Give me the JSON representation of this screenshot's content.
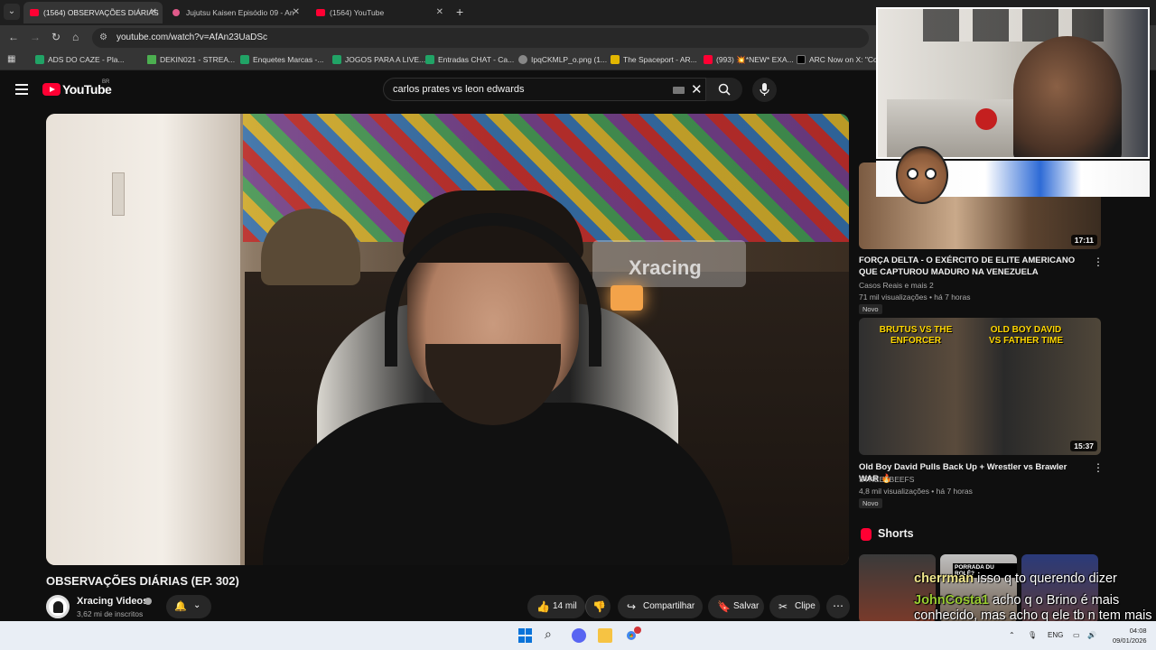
{
  "browser": {
    "tabs": [
      {
        "label": "(1564) OBSERVAÇÕES DIÁRIAS",
        "active": true
      },
      {
        "label": "Jujutsu Kaisen Episódio 09 - An",
        "active": false
      },
      {
        "label": "(1564) YouTube",
        "active": false
      }
    ],
    "url": "youtube.com/watch?v=AfAn23UaDSc",
    "bookmarks": [
      {
        "label": "ADS DO CAZE - Pla...",
        "icon": "sheets-icon"
      },
      {
        "label": "DEKIN021 - STREA...",
        "icon": "drive-icon"
      },
      {
        "label": "Enquetes Marcas -...",
        "icon": "sheets-icon"
      },
      {
        "label": "JOGOS PARA A LIVE...",
        "icon": "sheets-icon"
      },
      {
        "label": "Entradas CHAT - Ca...",
        "icon": "sheets-icon"
      },
      {
        "label": "IpqCKMLP_o.png (1...",
        "icon": "globe-icon"
      },
      {
        "label": "The Spaceport - AR...",
        "icon": "spaceport-icon"
      },
      {
        "label": "(993) 💥*NEW* EXA...",
        "icon": "youtube-icon"
      },
      {
        "label": "ARC Now on X: \"Co...",
        "icon": "x-icon"
      }
    ]
  },
  "youtube": {
    "logo_text": "YouTube",
    "country_code": "BR",
    "search_query": "carlos prates vs leon edwards",
    "player": {
      "brand_text": "Xracing"
    },
    "video": {
      "title": "OBSERVAÇÕES DIÁRIAS (EP. 302)",
      "channel": "Xracing Videos",
      "subscribers": "3,62 mi de inscritos",
      "likes": "14 mil",
      "share_label": "Compartilhar",
      "save_label": "Salvar",
      "clip_label": "Clipe"
    },
    "recommendations": [
      {
        "title": "FORÇA DELTA - O EXÉRCITO DE ELITE AMERICANO QUE CAPTUROU MADURO NA VENEZUELA",
        "channel": "Casos Reais e mais 2",
        "meta": "71 mil visualizações • há 7 horas",
        "badge": "Novo",
        "duration": "17:11"
      },
      {
        "title": "Old Boy David Pulls Back Up + Wrestler vs Brawler WAR 🔥",
        "channel": "STREETBEEFS",
        "meta": "4,8 mil visualizações • há 7 horas",
        "badge": "Novo",
        "duration": "15:37",
        "thumb_text_left": "BRUTUS VS THE ENFORCER",
        "thumb_text_right": "OLD BOY DAVID VS FATHER TIME"
      }
    ],
    "shorts_label": "Shorts",
    "short_thumb_text": "PORRADA DU ROLÊ?"
  },
  "chat": [
    {
      "user": "cherrman",
      "message": "isso q to querendo dizer",
      "user_color": "#f0e68c"
    },
    {
      "user": "JohnCosta1",
      "message": "acho q o Brino é mais conhecido, mas acho q ele tb n tem mais grana q o Alan",
      "user_color": "#9acd32"
    }
  ],
  "taskbar": {
    "language": "ENG",
    "time": "04:08",
    "date": "09/01/2026"
  },
  "colors": {
    "yt_red": "#ff0033",
    "background": "#0f0f0f",
    "chip": "#272727"
  }
}
